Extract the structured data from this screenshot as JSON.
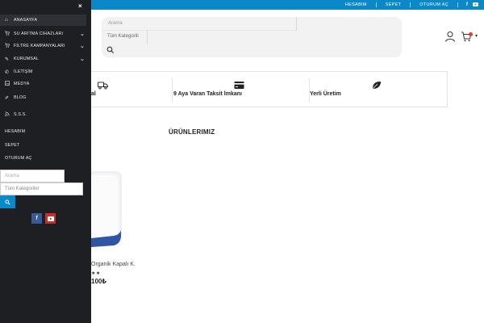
{
  "topbar": {
    "links": [
      "HESABIM",
      "SEPET",
      "OTURUM AÇ"
    ],
    "social": [
      "facebook-icon",
      "youtube-icon"
    ],
    "color": "#0a88c8"
  },
  "search": {
    "placeholder": "Arama",
    "category": "Tüm Kategorili"
  },
  "features": [
    {
      "icon": "truck-icon",
      "label": "al"
    },
    {
      "icon": "credit-card-icon",
      "label": "9 Aya Varan Taksit İmkanı"
    },
    {
      "icon": "leaf-icon",
      "label": "Yerli Üretim"
    }
  ],
  "section": {
    "title": "ÜRÜNLERIMIZ"
  },
  "product": {
    "name": "Organik Kapalı K.",
    "stars": "★★",
    "price": "100₺"
  },
  "drawer": {
    "close": "×",
    "menu": [
      {
        "icon": "home-icon",
        "label": "ANASAYFA",
        "chevron": false,
        "active": true
      },
      {
        "icon": "cart-icon",
        "label": "SU ARITMA CIHAZLARI",
        "chevron": true,
        "active": false
      },
      {
        "icon": "cart-icon",
        "label": "FİLTRE KAMPANYALARI",
        "chevron": true,
        "active": false
      },
      {
        "icon": "pin-icon",
        "label": "KURUMSAL",
        "chevron": true,
        "active": false
      },
      {
        "icon": "phone-icon",
        "label": "İLETİŞİM",
        "chevron": false,
        "active": false
      },
      {
        "icon": "image-icon",
        "label": "MEDYA",
        "chevron": false,
        "active": false
      },
      {
        "icon": "pencil-icon",
        "label": "BLOG",
        "chevron": false,
        "active": false
      },
      {
        "icon": "rss-icon",
        "label": "S.S.S.",
        "chevron": false,
        "active": false
      }
    ],
    "account": [
      "HESABIM",
      "SEPET",
      "OTURUM AÇ"
    ],
    "search_placeholder": "Arama",
    "category": "Tüm Kategoriler",
    "facebook": "f"
  }
}
